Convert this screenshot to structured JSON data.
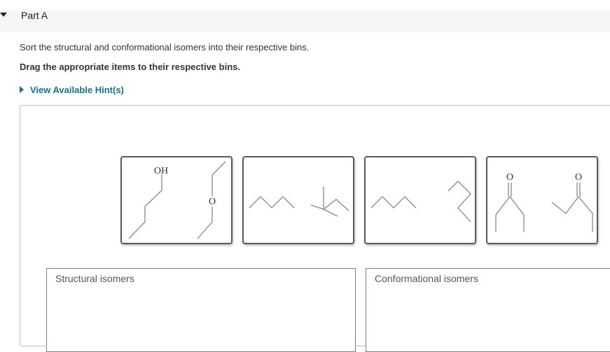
{
  "part": {
    "title": "Part A"
  },
  "instructions": {
    "line1": "Sort the structural and conformational isomers into their respective bins.",
    "line2": "Drag the appropriate items to their respective bins."
  },
  "hint": {
    "label": "View Available Hint(s)"
  },
  "tiles": [
    {
      "atoms": [
        "OH",
        "O"
      ]
    },
    {
      "atoms": []
    },
    {
      "atoms": []
    },
    {
      "atoms": [
        "O",
        "O"
      ]
    }
  ],
  "bins": [
    {
      "label": "Structural isomers"
    },
    {
      "label": "Conformational isomers"
    }
  ],
  "colors": {
    "accent": "#1b6f8c",
    "bond": "#888888",
    "tile_border": "#5a5a5a"
  }
}
